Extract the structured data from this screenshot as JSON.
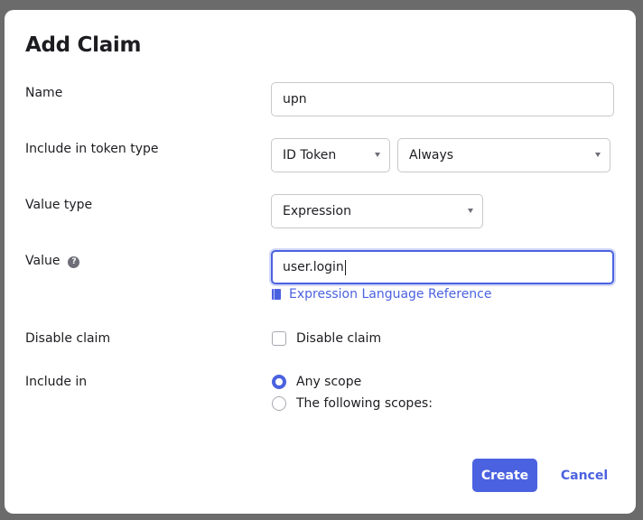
{
  "dialog": {
    "title": "Add Claim",
    "name": {
      "label": "Name",
      "value": "upn"
    },
    "token_type": {
      "label": "Include in token type",
      "token_select": "ID Token",
      "when_select": "Always"
    },
    "value_type": {
      "label": "Value type",
      "selected": "Expression"
    },
    "value": {
      "label": "Value",
      "help_icon": "?",
      "input_value": "user.login",
      "link_text": "Expression Language Reference"
    },
    "disable_claim": {
      "label": "Disable claim",
      "checkbox_label": "Disable claim",
      "checked": false
    },
    "include_in": {
      "label": "Include in",
      "options": [
        "Any scope",
        "The following scopes:"
      ],
      "selected": "Any scope"
    },
    "buttons": {
      "create": "Create",
      "cancel": "Cancel"
    }
  },
  "colors": {
    "accent": "#4b62e0",
    "text": "#1d1d21",
    "border": "#c8c8cd",
    "overlay": "#6b6b6b"
  }
}
